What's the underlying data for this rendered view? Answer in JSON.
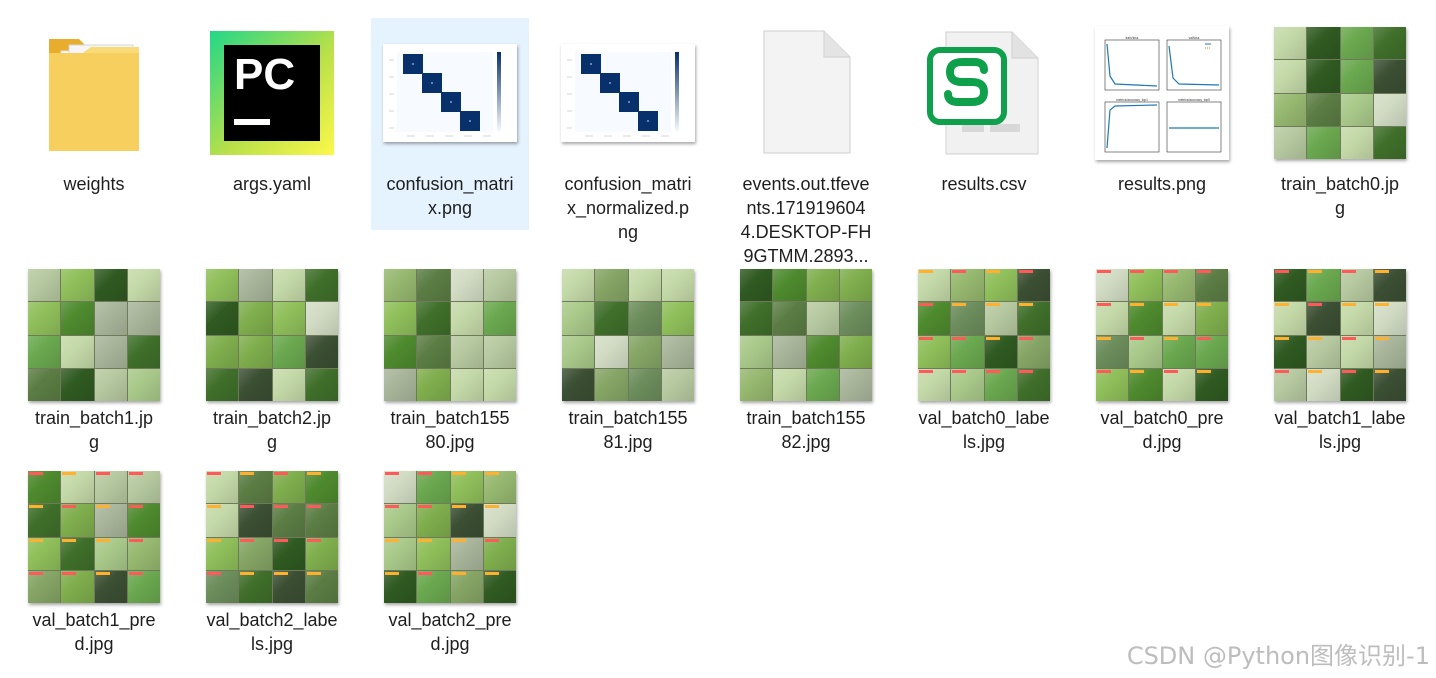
{
  "files": [
    {
      "name": "weights",
      "icon": "folder-icon",
      "kind": "folder",
      "selected": false
    },
    {
      "name": "args.yaml",
      "icon": "pycharm-icon",
      "kind": "pycharm",
      "selected": false
    },
    {
      "name": "confusion_matrix.png",
      "icon": "confusion-matrix-thumbnail",
      "kind": "cm",
      "selected": true
    },
    {
      "name": "confusion_matrix_normalized.png",
      "icon": "confusion-matrix-normalized-thumbnail",
      "kind": "cm",
      "selected": false
    },
    {
      "name": "events.out.tfevents.1719196044.DESKTOP-FH9GTMM.2893...",
      "icon": "blank-file-icon",
      "kind": "blank",
      "selected": false
    },
    {
      "name": "results.csv",
      "icon": "spreadsheet-icon",
      "kind": "csv",
      "selected": false
    },
    {
      "name": "results.png",
      "icon": "results-plot-thumbnail",
      "kind": "results",
      "selected": false
    },
    {
      "name": "train_batch0.jpg",
      "icon": "image-mosaic-thumbnail",
      "kind": "mosaic",
      "selected": false
    },
    {
      "name": "train_batch1.jpg",
      "icon": "image-mosaic-thumbnail",
      "kind": "mosaic",
      "selected": false
    },
    {
      "name": "train_batch2.jpg",
      "icon": "image-mosaic-thumbnail",
      "kind": "mosaic",
      "selected": false
    },
    {
      "name": "train_batch15580.jpg",
      "icon": "image-mosaic-thumbnail",
      "kind": "mosaic",
      "selected": false
    },
    {
      "name": "train_batch15581.jpg",
      "icon": "image-mosaic-thumbnail",
      "kind": "mosaic",
      "selected": false
    },
    {
      "name": "train_batch15582.jpg",
      "icon": "image-mosaic-thumbnail",
      "kind": "mosaic",
      "selected": false
    },
    {
      "name": "val_batch0_labels.jpg",
      "icon": "image-mosaic-thumbnail",
      "kind": "mosaic-lbl",
      "selected": false
    },
    {
      "name": "val_batch0_pred.jpg",
      "icon": "image-mosaic-thumbnail",
      "kind": "mosaic-lbl",
      "selected": false
    },
    {
      "name": "val_batch1_labels.jpg",
      "icon": "image-mosaic-thumbnail",
      "kind": "mosaic-lbl",
      "selected": false
    },
    {
      "name": "val_batch1_pred.jpg",
      "icon": "image-mosaic-thumbnail",
      "kind": "mosaic-lbl",
      "selected": false
    },
    {
      "name": "val_batch2_labels.jpg",
      "icon": "image-mosaic-thumbnail",
      "kind": "mosaic-lbl",
      "selected": false
    },
    {
      "name": "val_batch2_pred.jpg",
      "icon": "image-mosaic-thumbnail",
      "kind": "mosaic-lbl",
      "selected": false
    }
  ],
  "labels": [
    [
      "weights"
    ],
    [
      "args.yaml"
    ],
    [
      "confusion_matri",
      "x.png"
    ],
    [
      "confusion_matri",
      "x_normalized.p",
      "ng"
    ],
    [
      "events.out.tfeve",
      "nts.171919604",
      "4.DESKTOP-FH",
      "9GTMM.2893..."
    ],
    [
      "results.csv"
    ],
    [
      "results.png"
    ],
    [
      "train_batch0.jp",
      "g"
    ],
    [
      "train_batch1.jp",
      "g"
    ],
    [
      "train_batch2.jp",
      "g"
    ],
    [
      "train_batch155",
      "80.jpg"
    ],
    [
      "train_batch155",
      "81.jpg"
    ],
    [
      "train_batch155",
      "82.jpg"
    ],
    [
      "val_batch0_labe",
      "ls.jpg"
    ],
    [
      "val_batch0_pre",
      "d.jpg"
    ],
    [
      "val_batch1_labe",
      "ls.jpg"
    ],
    [
      "val_batch1_pre",
      "d.jpg"
    ],
    [
      "val_batch2_labe",
      "ls.jpg"
    ],
    [
      "val_batch2_pre",
      "d.jpg"
    ]
  ],
  "results_plot_titles": [
    "train/loss",
    "val/loss",
    "metrics/accuracy_top1",
    "metrics/accuracy_top5"
  ],
  "watermark": "CSDN @Python图像识别-1",
  "colors": {
    "selection": "#e5f3ff",
    "folder": "#f5c343",
    "pycharm_green": "#21d789",
    "pycharm_yellow": "#fcf84a",
    "csv_green": "#0fa04b",
    "cm_blue": "#08306b",
    "leaf_green": "#5e9a3a"
  }
}
